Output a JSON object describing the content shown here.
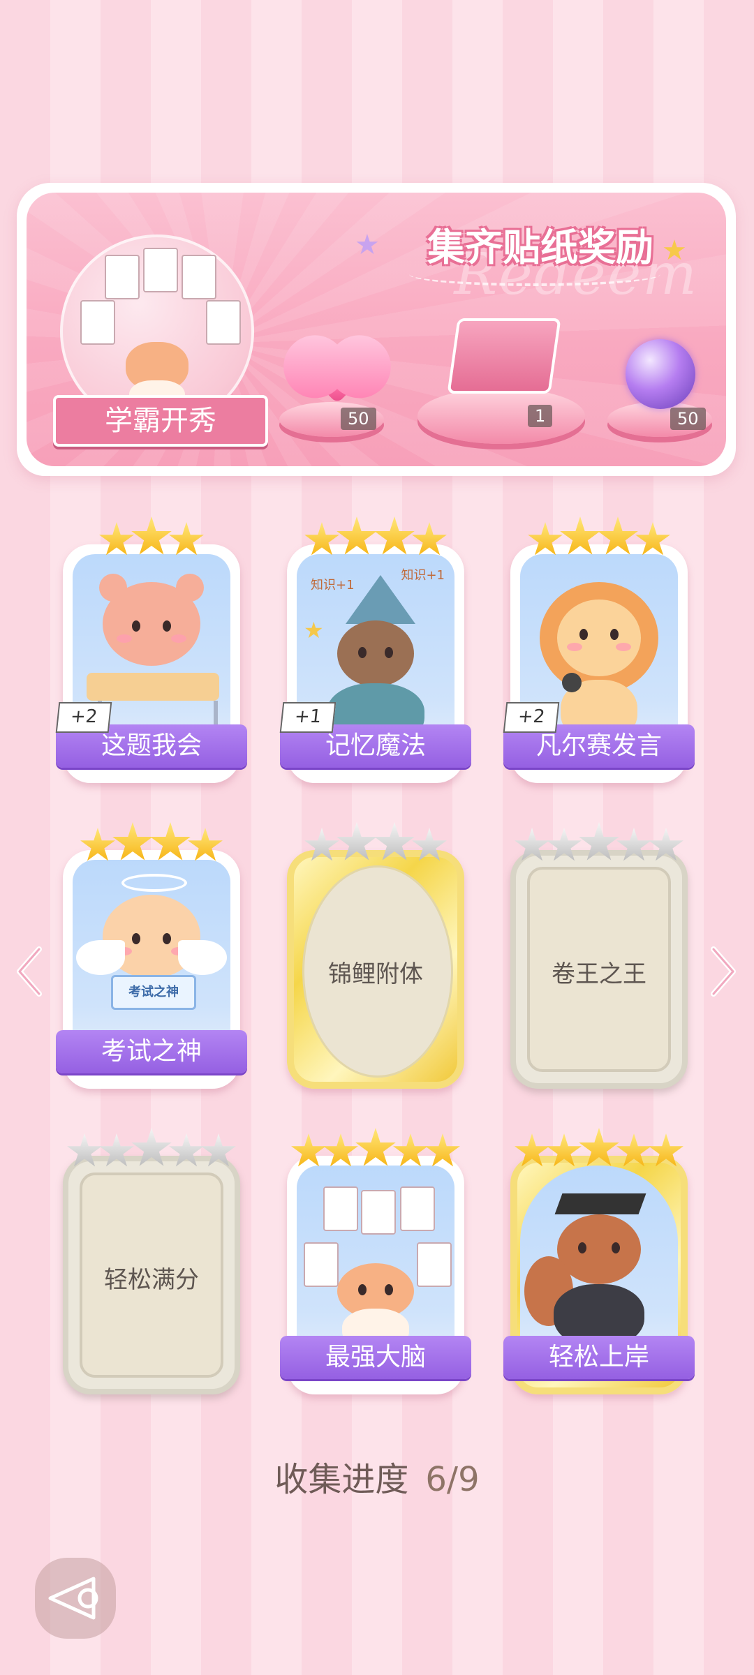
{
  "banner": {
    "title": "集齐贴纸奖励",
    "watermark": "Redeem",
    "theme_label": "学霸开秀",
    "rewards": [
      {
        "icon": "pink-heart-gem-icon",
        "count": "50"
      },
      {
        "icon": "gift-box-icon",
        "count": "1"
      },
      {
        "icon": "purple-lightning-orb-icon",
        "count": "50"
      }
    ]
  },
  "stickers": [
    {
      "name": "这题我会",
      "stars": 3,
      "bonus": "+2",
      "state": "collected",
      "art": "bear-at-desk"
    },
    {
      "name": "记忆魔法",
      "stars": 4,
      "bonus": "+1",
      "state": "collected",
      "art": "otter-wizard"
    },
    {
      "name": "凡尔赛发言",
      "stars": 4,
      "bonus": "+2",
      "state": "collected",
      "art": "lion-microphone"
    },
    {
      "name": "考试之神",
      "stars": 4,
      "bonus": "",
      "state": "collected",
      "art": "angel-cat",
      "sign": "考试之神"
    },
    {
      "name": "锦鲤附体",
      "stars": 4,
      "bonus": "",
      "state": "locked-gold"
    },
    {
      "name": "卷王之王",
      "stars": 5,
      "bonus": "",
      "state": "locked"
    },
    {
      "name": "轻松满分",
      "stars": 5,
      "bonus": "",
      "state": "locked"
    },
    {
      "name": "最强大脑",
      "stars": 5,
      "bonus": "",
      "state": "collected",
      "art": "cat-papers"
    },
    {
      "name": "轻松上岸",
      "stars": 5,
      "bonus": "",
      "state": "collected-gold",
      "art": "squirrel-graduate"
    }
  ],
  "art_text": {
    "wizard_left": "知识+1",
    "wizard_right": "知识+1"
  },
  "progress": {
    "label": "收集进度",
    "value": "6/9"
  },
  "colors": {
    "accent_pink": "#ec7da0",
    "name_purple": "#9560e2",
    "star_gold": "#f6b10f"
  }
}
